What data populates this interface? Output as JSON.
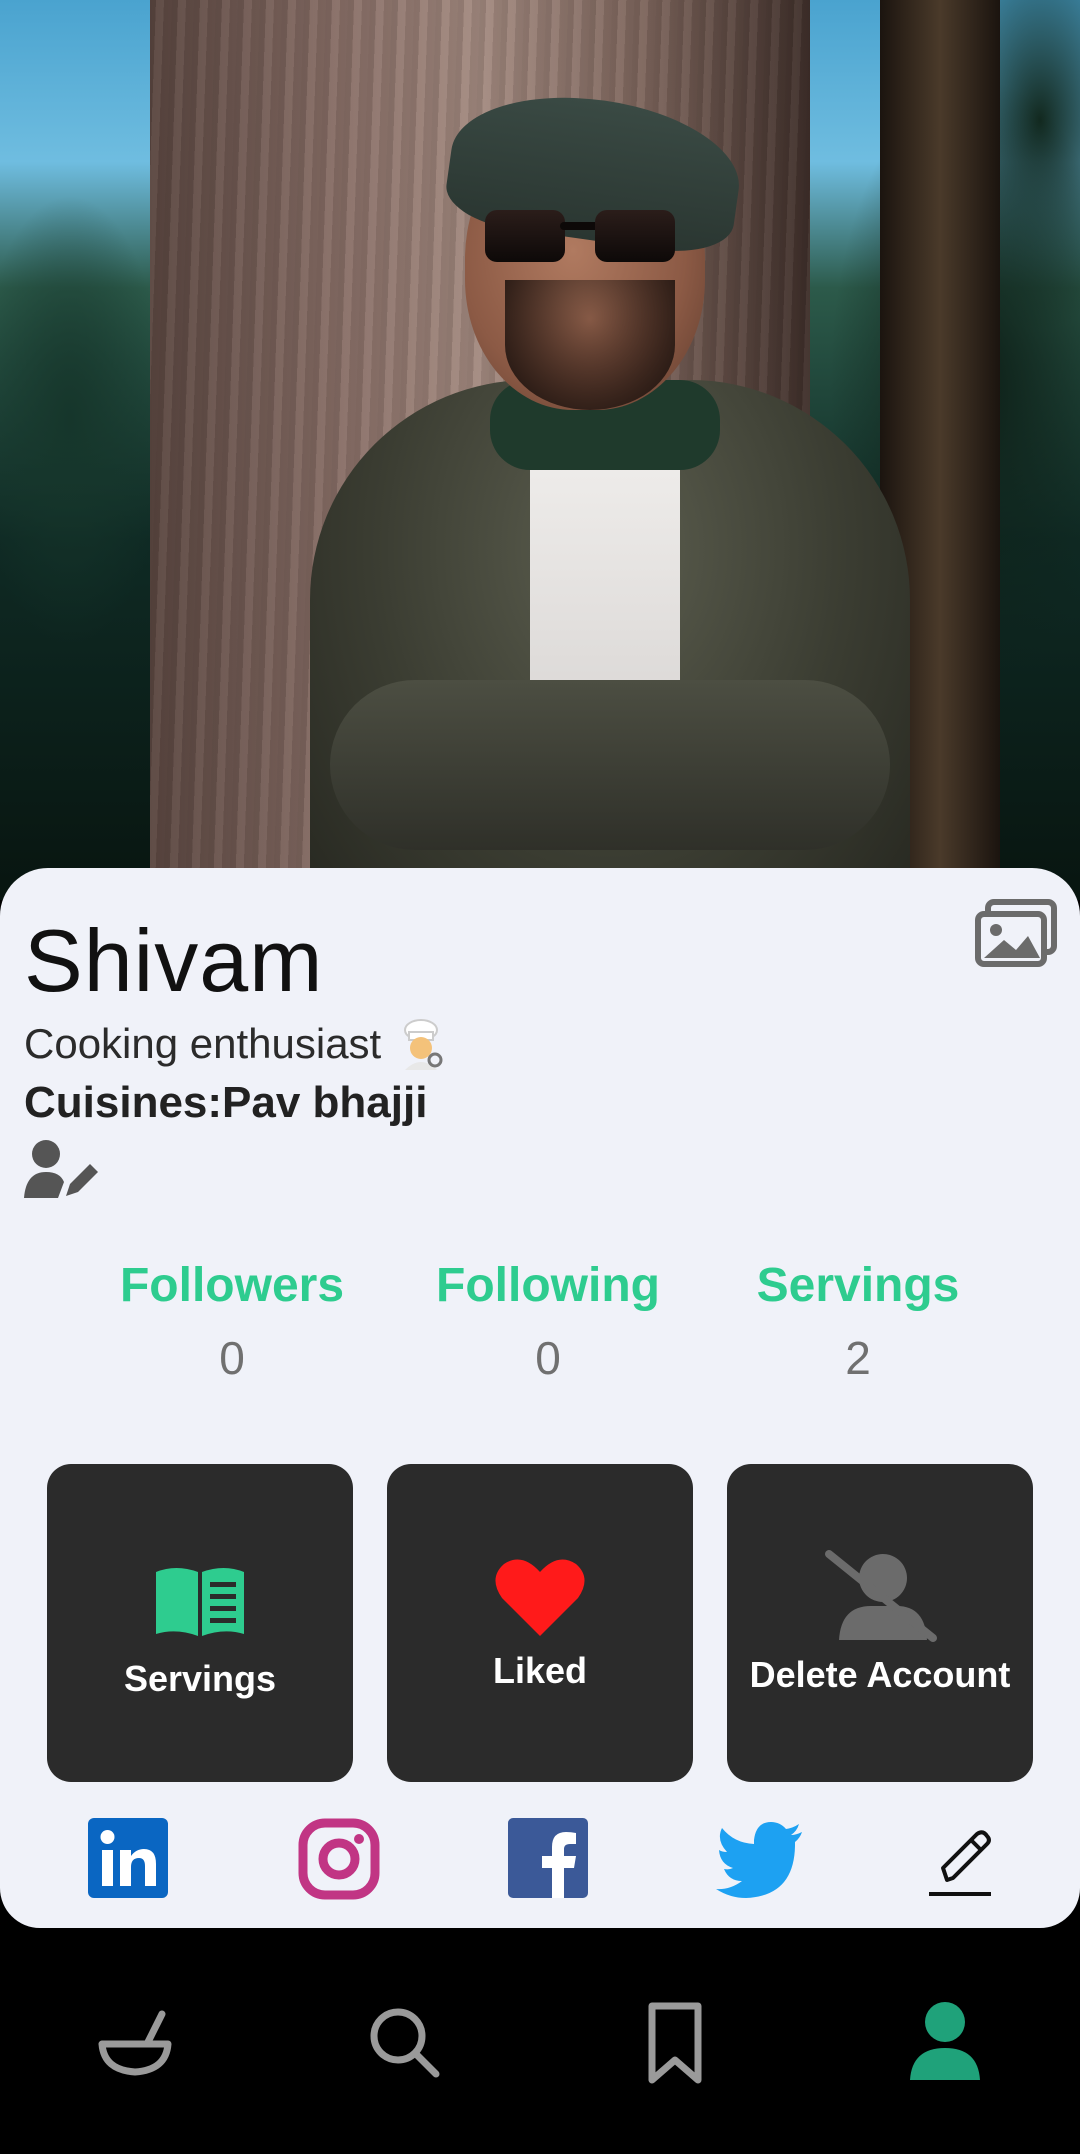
{
  "profile": {
    "name": "Shivam",
    "bio": "Cooking enthusiast",
    "bio_emoji_icon": "chef-emoji-icon",
    "cuisines": "Cuisines:Pav bhajji"
  },
  "stats": {
    "followers_label": "Followers",
    "followers_value": "0",
    "following_label": "Following",
    "following_value": "0",
    "servings_label": "Servings",
    "servings_value": "2"
  },
  "tiles": {
    "servings_label": "Servings",
    "liked_label": "Liked",
    "delete_label": "Delete Account"
  },
  "icons": {
    "gallery": "gallery-icon",
    "edit_profile": "user-edit-icon",
    "servings": "open-book-icon",
    "liked": "heart-icon",
    "delete": "user-slash-icon",
    "linkedin": "linkedin-icon",
    "instagram": "instagram-icon",
    "facebook": "facebook-icon",
    "twitter": "twitter-icon",
    "edit_socials": "pencil-icon",
    "nav": [
      "bowl-icon",
      "search-icon",
      "bookmark-icon",
      "profile-icon"
    ]
  },
  "colors": {
    "accent": "#2ecc8f",
    "card_background": "#f0f2f9",
    "tile_background": "#2b2b2b",
    "heart": "#ff1a1a",
    "linkedin": "#0a66c2",
    "instagram": "#c13584",
    "facebook": "#3b5998",
    "twitter": "#1da1f2",
    "nav_active": "#1fa27a",
    "nav_inactive": "#9a9a9a"
  },
  "bottom_nav": {
    "active": "profile"
  }
}
